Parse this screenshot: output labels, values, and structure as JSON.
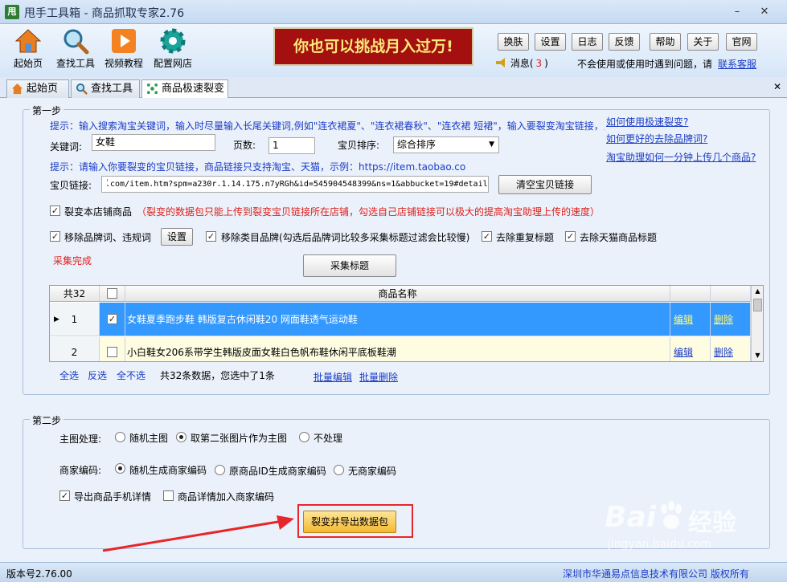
{
  "window": {
    "logo": "甩",
    "title": "甩手工具箱 - 商品抓取专家2.76",
    "minimize": "–",
    "close": "✕"
  },
  "toolbar": [
    {
      "label": "起始页",
      "icon": "home-icon"
    },
    {
      "label": "查找工具",
      "icon": "magnifier-icon"
    },
    {
      "label": "视频教程",
      "icon": "play-icon"
    },
    {
      "label": "配置网店",
      "icon": "gear-icon"
    }
  ],
  "banner": "你也可以挑战月入过万!",
  "top_buttons": [
    "换肤",
    "设置",
    "日志",
    "反馈",
    "帮助",
    "关于",
    "官网"
  ],
  "messages": {
    "label": "消息(",
    "count": "3",
    "close_paren": ")",
    "note": "不会使用或使用时遇到问题，请",
    "link": "联系客服"
  },
  "tabs": [
    {
      "label": "起始页",
      "icon": "home-icon"
    },
    {
      "label": "查找工具",
      "icon": "magnifier-icon"
    },
    {
      "label": "商品极速裂变",
      "icon": "split-icon",
      "active": true
    }
  ],
  "tabbar_close": "✕",
  "step1": {
    "title": "第一步",
    "hint1": "提示：输入搜索淘宝关键词，输入时尽量输入长尾关键词,例如\"连衣裙夏\"、\"连衣裙春秋\"、\"连衣裙 短裙\"，输入要裂变淘宝链接，点击采集标题",
    "keyword_label": "关键词:",
    "keyword_value": "女鞋",
    "pages_label": "页数:",
    "pages_value": "1",
    "sort_label": "宝贝排序:",
    "sort_value": "综合排序",
    "help_links": [
      "如何使用极速裂变?",
      "如何更好的去除品牌词?",
      "淘宝助理如何一分钟上传几个商品?"
    ],
    "hint2": "提示：请输入你要裂变的宝贝链接，商品链接只支持淘宝、天猫，示例：https://item.taobao.co",
    "link_label": "宝贝链接:",
    "link_value": "ٰ.com/item.htm?spm=a230r.1.14.175.n7yRGh&id=545904548399&ns=1&abbucket=19#detail",
    "clear_btn": "清空宝贝链接",
    "own_shop_label": "裂变本店铺商品",
    "own_shop_note": "（裂变的数据包只能上传到裂变宝贝链接所在店铺，勾选自己店铺链接可以极大的提高淘宝助理上传的速度）",
    "opt_remove_brand": "移除品牌词、违规词",
    "settings_btn": "设置",
    "opt_remove_cat_brand": "移除类目品牌(勾选后品牌词比较多采集标题过滤会比较慢)",
    "opt_dedupe": "去除重复标题",
    "opt_tmall": "去除天猫商品标题",
    "status": "采集完成",
    "collect_btn": "采集标题"
  },
  "grid": {
    "count_header": "共32",
    "name_header": "商品名称",
    "rows": [
      {
        "index": "1",
        "name": "女鞋夏季跑步鞋 韩版复古休闲鞋20 网面鞋透气运动鞋",
        "edit": "编辑",
        "delete": "删除"
      },
      {
        "index": "2",
        "name": "小白鞋女206系带学生韩版皮面女鞋白色帆布鞋休闲平底板鞋潮",
        "edit": "编辑",
        "delete": "删除"
      }
    ]
  },
  "grid_footer": {
    "select_all": "全选",
    "invert": "反选",
    "select_none": "全不选",
    "summary": "共32条数据，您选中了1条",
    "batch_edit": "批量编辑",
    "batch_delete": "批量删除"
  },
  "step2": {
    "title": "第二步",
    "main_img_label": "主图处理:",
    "main_img_options": [
      "随机主图",
      "取第二张图片作为主图",
      "不处理"
    ],
    "code_label": "商家编码:",
    "code_options": [
      "随机生成商家编码",
      "原商品ID生成商家编码",
      "无商家编码"
    ],
    "export_mobile": "导出商品手机详情",
    "detail_code": "商品详情加入商家编码",
    "export_btn": "裂变并导出数据包"
  },
  "status_bar": {
    "version": "版本号2.76.00",
    "copyright": "深圳市华通易点信息技术有限公司 版权所有"
  },
  "watermark": {
    "logo": "Bai",
    "cn": "经验",
    "url": "jingyan.baidu.com"
  },
  "colors": {
    "highlight_row": "#3399ff",
    "annotation": "#e8262a",
    "banner_bg": "#a3100f",
    "export_btn": "#f8c640"
  }
}
